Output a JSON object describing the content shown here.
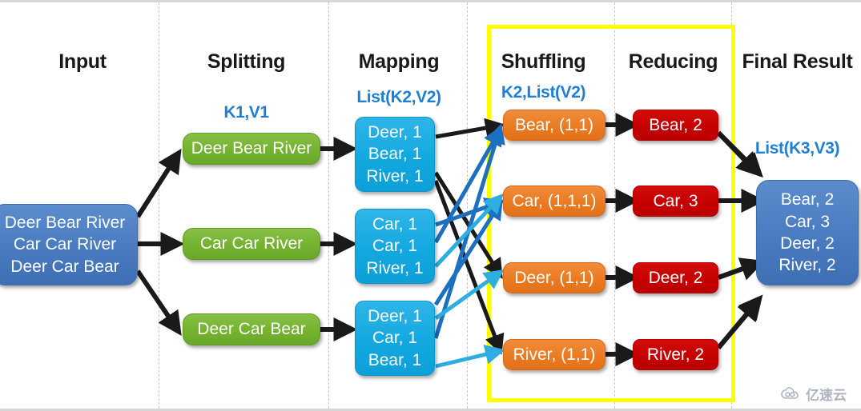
{
  "diagram": {
    "title": "MapReduce WordCount dataflow",
    "watermark": {
      "text": "亿速云",
      "icon": "cloud-logo-icon"
    },
    "highlight": {
      "color": "#ffff00",
      "covers": [
        "Shuffling",
        "Reducing"
      ]
    },
    "colors": {
      "input": "#4a7bc0",
      "splitting": "#74b22f",
      "mapping": "#13a8e0",
      "shuffling": "#ea7b22",
      "reducing": "#c60000",
      "final": "#4a7bc0",
      "header": "#17191c",
      "subheader": "#1f7fd4",
      "highlight": "#ffff00",
      "wire_black": "#1a1a1a",
      "wire_blue": "#1d6fc0",
      "wire_lightblue": "#2eaee0"
    },
    "columns": [
      {
        "id": "input",
        "header": "Input",
        "subheader": ""
      },
      {
        "id": "splitting",
        "header": "Splitting",
        "subheader": "K1,V1"
      },
      {
        "id": "mapping",
        "header": "Mapping",
        "subheader": "List(K2,V2)"
      },
      {
        "id": "shuffling",
        "header": "Shuffling",
        "subheader": "K2,List(V2)"
      },
      {
        "id": "reducing",
        "header": "Reducing",
        "subheader": ""
      },
      {
        "id": "final",
        "header": "Final Result",
        "subheader": "List(K3,V3)"
      }
    ],
    "input_box": {
      "lines": [
        "Deer Bear River",
        "Car Car River",
        "Deer Car Bear"
      ]
    },
    "splits": [
      {
        "label": "Deer Bear River"
      },
      {
        "label": "Car Car River"
      },
      {
        "label": "Deer Car Bear"
      }
    ],
    "maps": [
      {
        "lines": [
          "Deer, 1",
          "Bear, 1",
          "River, 1"
        ]
      },
      {
        "lines": [
          "Car, 1",
          "Car, 1",
          "River, 1"
        ]
      },
      {
        "lines": [
          "Deer, 1",
          "Car, 1",
          "Bear, 1"
        ]
      }
    ],
    "shuffles": [
      {
        "label": "Bear, (1,1)"
      },
      {
        "label": "Car, (1,1,1)"
      },
      {
        "label": "Deer, (1,1)"
      },
      {
        "label": "River, (1,1)"
      }
    ],
    "reduces": [
      {
        "label": "Bear, 2"
      },
      {
        "label": "Car, 3"
      },
      {
        "label": "Deer, 2"
      },
      {
        "label": "River, 2"
      }
    ],
    "final_box": {
      "lines": [
        "Bear, 2",
        "Car, 3",
        "Deer, 2",
        "River, 2"
      ]
    }
  }
}
